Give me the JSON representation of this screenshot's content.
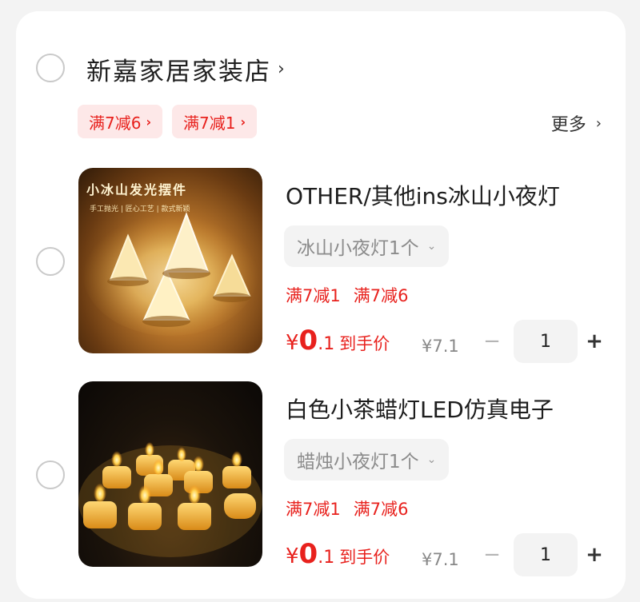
{
  "shop": {
    "name": "新嘉家居家装店",
    "chevron": "›",
    "coupons": [
      "满7减6",
      "满7减1"
    ],
    "more_label": "更多",
    "more_chevron": "›"
  },
  "items": [
    {
      "title": "OTHER/其他ins冰山小夜灯",
      "variant": "冰山小夜灯1个",
      "promos": [
        "满7减1",
        "满7减6"
      ],
      "price_symbol": "¥",
      "price_int": "0",
      "price_dec": ".1",
      "price_tag": "到手价",
      "original_price": "¥7.1",
      "quantity": "1",
      "image_text": {
        "banner": "小冰山发光摆件",
        "sub": "手工抛光 | 匠心工艺 | 款式新颖"
      }
    },
    {
      "title": "白色小茶蜡灯LED仿真电子",
      "variant": "蜡烛小夜灯1个",
      "promos": [
        "满7减1",
        "满7减6"
      ],
      "price_symbol": "¥",
      "price_int": "0",
      "price_dec": ".1",
      "price_tag": "到手价",
      "original_price": "¥7.1",
      "quantity": "1"
    }
  ],
  "icons": {
    "minus": "−",
    "plus": "+",
    "variant_chevron": "⌄"
  },
  "colors": {
    "accent": "#e8211d",
    "coupon_bg": "#fde8e8"
  }
}
